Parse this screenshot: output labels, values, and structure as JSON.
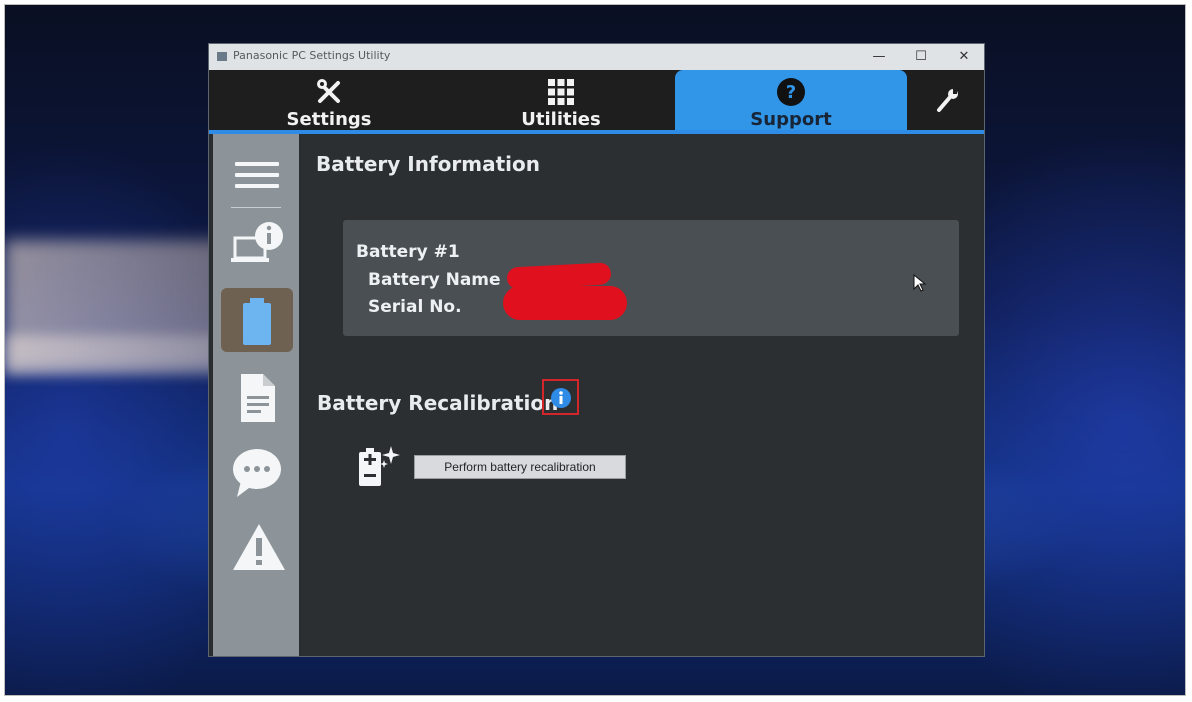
{
  "window": {
    "title": "Panasonic PC Settings Utility",
    "controls": {
      "minimize": "—",
      "maximize": "☐",
      "close": "✕"
    }
  },
  "tabs": [
    {
      "label": "Settings",
      "icon": "wrench-screwdriver-icon"
    },
    {
      "label": "Utilities",
      "icon": "grid-icon"
    },
    {
      "label": "Support",
      "icon": "question-circle-icon",
      "active": true
    },
    {
      "label": "",
      "icon": "wrench-icon"
    }
  ],
  "sidebar": {
    "items": [
      {
        "icon": "menu-icon"
      },
      {
        "icon": "pc-info-icon"
      },
      {
        "icon": "battery-icon",
        "active": true
      },
      {
        "icon": "document-icon"
      },
      {
        "icon": "chat-icon"
      },
      {
        "icon": "warning-icon"
      }
    ]
  },
  "content": {
    "battery_information_title": "Battery Information",
    "battery": {
      "number_label": "Battery #1",
      "name_label": "Battery Name",
      "serial_label": "Serial No."
    },
    "recalibration": {
      "title": "Battery Recalibration",
      "button_label": "Perform battery recalibration"
    }
  },
  "colors": {
    "accent": "#3195e8",
    "redaction": "#e0101e",
    "highlight_box": "#d3262a"
  }
}
